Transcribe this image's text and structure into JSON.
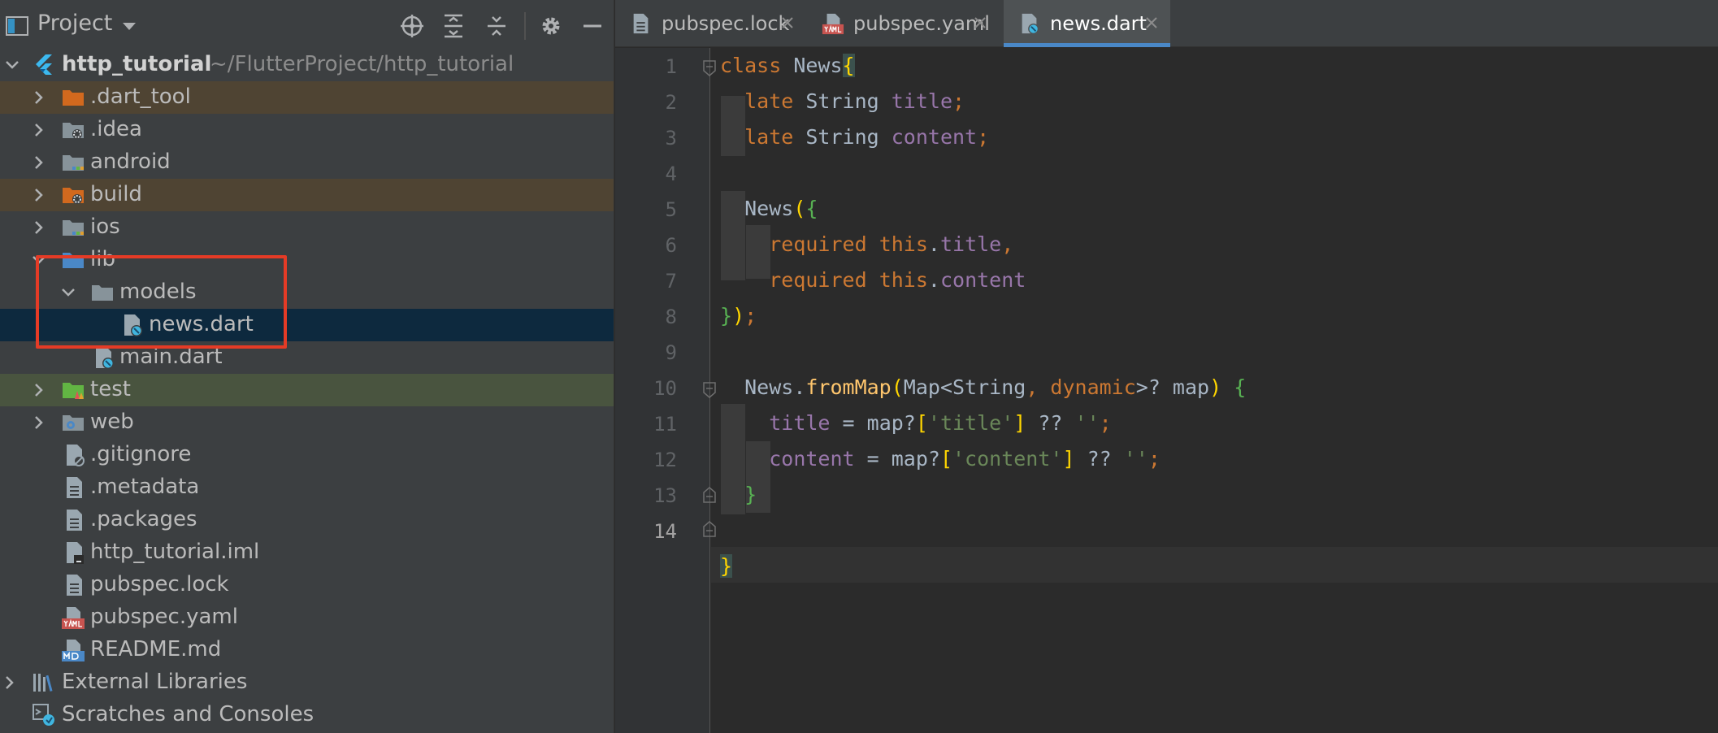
{
  "project_panel": {
    "title": "Project",
    "root": {
      "name": "http_tutorial",
      "path": "~/FlutterProject/http_tutorial"
    },
    "items": [
      {
        "label": ".dart_tool",
        "type": "folder-excluded"
      },
      {
        "label": ".idea",
        "type": "folder-config"
      },
      {
        "label": "android",
        "type": "folder-module"
      },
      {
        "label": "build",
        "type": "folder-excluded"
      },
      {
        "label": "ios",
        "type": "folder-module"
      },
      {
        "label": "lib",
        "type": "folder-source"
      },
      {
        "label": "models",
        "type": "folder"
      },
      {
        "label": "news.dart",
        "type": "dart-file",
        "selected": true
      },
      {
        "label": "main.dart",
        "type": "dart-file"
      },
      {
        "label": "test",
        "type": "folder-test"
      },
      {
        "label": "web",
        "type": "folder-web"
      },
      {
        "label": ".gitignore",
        "type": "ignore-file"
      },
      {
        "label": ".metadata",
        "type": "text-file"
      },
      {
        "label": ".packages",
        "type": "text-file"
      },
      {
        "label": "http_tutorial.iml",
        "type": "iml-file"
      },
      {
        "label": "pubspec.lock",
        "type": "text-file"
      },
      {
        "label": "pubspec.yaml",
        "type": "yaml-file"
      },
      {
        "label": "README.md",
        "type": "md-file"
      }
    ],
    "external_libraries": "External Libraries",
    "scratches": "Scratches and Consoles",
    "icons": {
      "project": "project-window-icon",
      "dropdown": "chevron-down-icon",
      "locate": "crosshair-icon",
      "expand_all": "expand-all-icon",
      "collapse_all": "collapse-all-icon",
      "settings": "gear-icon",
      "hide": "minus-icon"
    }
  },
  "editor": {
    "tabs": [
      {
        "label": "pubspec.lock",
        "icon": "text-file-icon",
        "active": false
      },
      {
        "label": "pubspec.yaml",
        "icon": "yaml-file-icon",
        "active": false
      },
      {
        "label": "news.dart",
        "icon": "dart-file-icon",
        "active": true
      }
    ],
    "line_numbers": [
      "1",
      "2",
      "3",
      "4",
      "5",
      "6",
      "7",
      "8",
      "9",
      "10",
      "11",
      "12",
      "13",
      "14"
    ],
    "current_line": 14,
    "code": {
      "l1_kw": "class",
      "l1_name": " News",
      "l1_brace": "{",
      "l2_kw": "late",
      "l2_type": " String ",
      "l2_field": "title",
      "l2_end": ";",
      "l3_kw": "late",
      "l3_type": " String ",
      "l3_field": "content",
      "l3_end": ";",
      "l5_name": "News",
      "l5_paren": "(",
      "l5_brace": "{",
      "l6_kw": "required",
      "l6_this": " this",
      "l6_dot": ".",
      "l6_field": "title",
      "l6_end": ",",
      "l7_kw": "required",
      "l7_this": " this",
      "l7_dot": ".",
      "l7_field": "content",
      "l8_brace": "}",
      "l8_paren": ")",
      "l8_end": ";",
      "l10_name": "News.",
      "l10_fn": "fromMap",
      "l10_paren": "(",
      "l10_type": "Map<String",
      "l10_comma": ", ",
      "l10_dyn": "dynamic",
      "l10_rest": ">? map",
      "l10_close": ")",
      "l10_sp": " ",
      "l10_brace": "{",
      "l11_field": "title",
      "l11_mid": " = map?",
      "l11_lb": "[",
      "l11_str": "'title'",
      "l11_rb": "]",
      "l11_op": " ?? ",
      "l11_str2": "''",
      "l11_end": ";",
      "l12_field": "content",
      "l12_mid": " = map?",
      "l12_lb": "[",
      "l12_str": "'content'",
      "l12_rb": "]",
      "l12_op": " ?? ",
      "l12_str2": "''",
      "l12_end": ";",
      "l13_brace": "}",
      "l14_brace": "}"
    }
  },
  "colors": {
    "accent": "#4a88c7",
    "highlight_border": "#e53b26",
    "keyword": "#cc7832",
    "field": "#9876aa",
    "function": "#ffc66d",
    "string": "#6a8759"
  }
}
